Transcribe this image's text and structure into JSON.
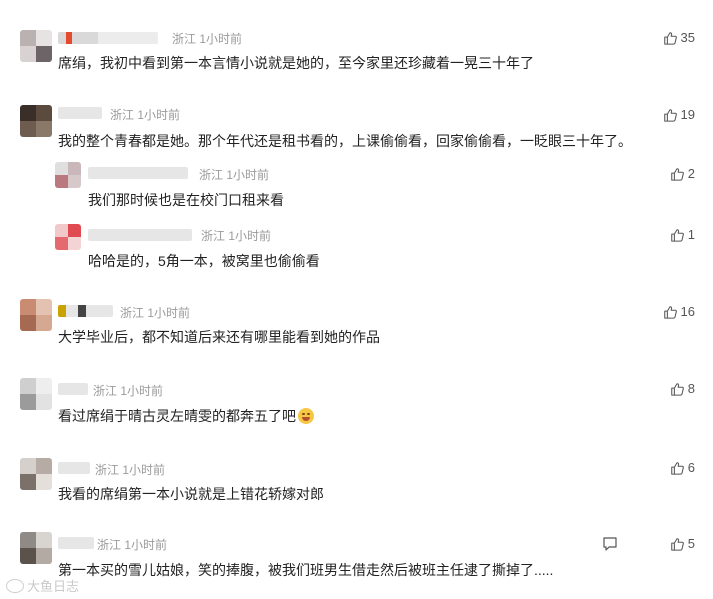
{
  "comments": [
    {
      "location": "浙江 1小时前",
      "text": "席绢，我初中看到第一本言情小说就是她的，至今家里还珍藏着一晃三十年了",
      "likes": "35"
    },
    {
      "location": "浙江 1小时前",
      "text": "我的整个青春都是她。那个年代还是租书看的，上课偷偷看，回家偷偷看，一眨眼三十年了。",
      "likes": "19"
    },
    {
      "location": "浙江 1小时前",
      "text": "我们那时候也是在校门口租来看",
      "likes": "2"
    },
    {
      "location": "浙江 1小时前",
      "text": "哈哈是的，5角一本，被窝里也偷偷看",
      "likes": "1"
    },
    {
      "location": "浙江 1小时前",
      "text": "大学毕业后，都不知道后来还有哪里能看到她的作品",
      "likes": "16"
    },
    {
      "location": "浙江 1小时前",
      "text": "看过席绢于晴古灵左晴雯的都奔五了吧",
      "likes": "8"
    },
    {
      "location": "浙江 1小时前",
      "text": "我看的席绢第一本小说就是上错花轿嫁对郎",
      "likes": "6"
    },
    {
      "location": "浙江 1小时前",
      "text": "第一本买的雪儿姑娘，笑的捧腹，被我们班男生借走然后被班主任逮了撕掉了.....",
      "likes": "5"
    }
  ],
  "icons": {
    "like": "thumbs-up-icon",
    "reply": "reply-icon",
    "watermark_logo": "watermark-logo-icon"
  },
  "watermark": {
    "text": "大鱼日志"
  },
  "colors": {
    "text": "#222222",
    "meta": "#9a9a9a",
    "like": "#555555"
  }
}
